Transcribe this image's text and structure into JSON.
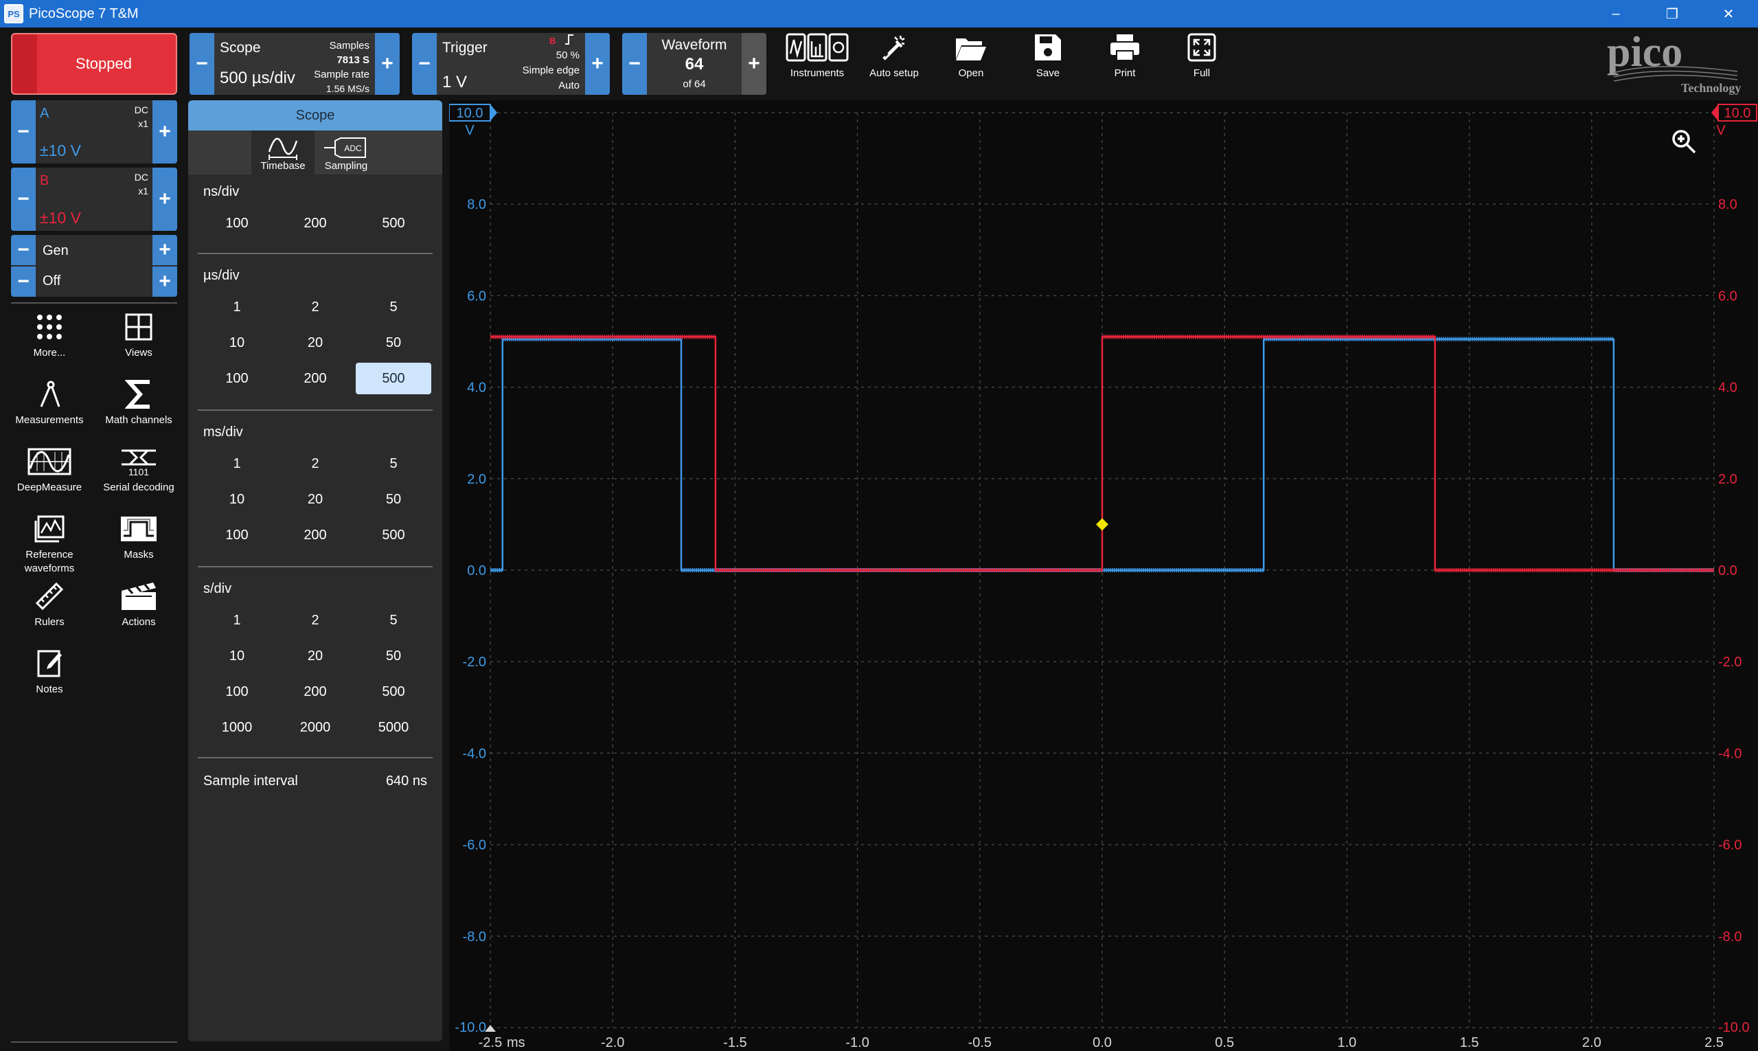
{
  "window": {
    "title": "PicoScope 7 T&M",
    "controls": [
      "–",
      "❐",
      "✕"
    ],
    "icon_text": "PS"
  },
  "run_state": "Stopped",
  "scope_group": {
    "label": "Scope",
    "timebase": "500 µs/div",
    "samples_label": "Samples",
    "samples_value": "7813 S",
    "sample_rate_label": "Sample rate",
    "sample_rate_value": "1.56 MS/s"
  },
  "trigger_group": {
    "label": "Trigger",
    "level": "1 V",
    "channel": "B",
    "percent": "50 %",
    "type": "Simple edge",
    "mode": "Auto"
  },
  "waveform_group": {
    "label": "Waveform",
    "current": "64",
    "of": "of 64"
  },
  "toolbar_buttons": [
    {
      "label": "Instruments",
      "icon": "instruments-icon"
    },
    {
      "label": "Auto setup",
      "icon": "auto-setup-icon"
    },
    {
      "label": "Open",
      "icon": "folder-open-icon"
    },
    {
      "label": "Save",
      "icon": "save-icon"
    },
    {
      "label": "Print",
      "icon": "print-icon"
    },
    {
      "label": "Full",
      "icon": "fullscreen-icon"
    }
  ],
  "logo": {
    "name": "pico",
    "sub": "Technology"
  },
  "channels": [
    {
      "name": "A",
      "coupling": "DC",
      "probe": "x1",
      "range": "±10 V",
      "color": "#3f9be8"
    },
    {
      "name": "B",
      "coupling": "DC",
      "probe": "x1",
      "range": "±10 V",
      "color": "#e8243c"
    }
  ],
  "gen": {
    "label": "Gen",
    "state": "Off"
  },
  "tools": [
    {
      "label": "More...",
      "icon": "more-grid-icon"
    },
    {
      "label": "Views",
      "icon": "views-icon"
    },
    {
      "label": "Measurements",
      "icon": "measurements-icon"
    },
    {
      "label": "Math channels",
      "icon": "sigma-icon"
    },
    {
      "label": "DeepMeasure",
      "icon": "deepmeasure-icon"
    },
    {
      "label": "Serial decoding",
      "icon": "serial-decoding-icon"
    },
    {
      "label": "Reference waveforms",
      "icon": "reference-waveforms-icon"
    },
    {
      "label": "Masks",
      "icon": "masks-icon"
    },
    {
      "label": "Rulers",
      "icon": "ruler-icon"
    },
    {
      "label": "Actions",
      "icon": "clapper-icon"
    },
    {
      "label": "Notes",
      "icon": "notes-icon"
    }
  ],
  "panel": {
    "title": "Scope",
    "tabs": [
      {
        "label": "Timebase",
        "icon": "timebase-icon"
      },
      {
        "label": "Sampling",
        "icon": "sampling-adc-icon"
      }
    ],
    "adc_text": "ADC",
    "sections": [
      {
        "title": "ns/div",
        "options": [
          "100",
          "200",
          "500"
        ]
      },
      {
        "title": "µs/div",
        "options": [
          "1",
          "2",
          "5",
          "10",
          "20",
          "50",
          "100",
          "200",
          "500"
        ]
      },
      {
        "title": "ms/div",
        "options": [
          "1",
          "2",
          "5",
          "10",
          "20",
          "50",
          "100",
          "200",
          "500"
        ]
      },
      {
        "title": "s/div",
        "options": [
          "1",
          "2",
          "5",
          "10",
          "20",
          "50",
          "100",
          "200",
          "500",
          "1000",
          "2000",
          "5000"
        ]
      }
    ],
    "selected": "µs/div:500",
    "sample_interval_label": "Sample interval",
    "sample_interval_value": "640 ns"
  },
  "plot": {
    "x_ticks": [
      "-2.5",
      "-2.0",
      "-1.5",
      "-1.0",
      "-0.5",
      "0.0",
      "0.5",
      "1.0",
      "1.5",
      "2.0",
      "2.5"
    ],
    "x_unit": "ms",
    "y_ticks_left": [
      "10.0",
      "8.0",
      "6.0",
      "4.0",
      "2.0",
      "0.0",
      "-2.0",
      "-4.0",
      "-6.0",
      "-8.0",
      "-10.0"
    ],
    "y_unit": "V",
    "colors": {
      "a": "#3f9be8",
      "b": "#e8243c",
      "grid": "#3c4a3c",
      "trigger": "#f2e600"
    }
  },
  "chart_data": {
    "type": "line",
    "xlim": [
      -2.5,
      2.5
    ],
    "ylim": [
      -10,
      10
    ],
    "x_unit": "ms",
    "y_unit": "V",
    "series": [
      {
        "name": "A",
        "x": [
          -2.5,
          -2.45,
          -2.45,
          -1.72,
          -1.72,
          0.66,
          0.66,
          2.09,
          2.09,
          2.5
        ],
        "values": [
          0,
          0,
          5.05,
          5.05,
          0,
          0,
          5.05,
          5.05,
          0,
          0
        ]
      },
      {
        "name": "B",
        "x": [
          -2.5,
          -1.58,
          -1.58,
          0.0,
          0.0,
          1.36,
          1.36,
          2.5
        ],
        "values": [
          5.1,
          5.1,
          0,
          0,
          5.1,
          5.1,
          0,
          0
        ]
      }
    ],
    "trigger": {
      "x": 0.0,
      "y": 1.0
    }
  }
}
